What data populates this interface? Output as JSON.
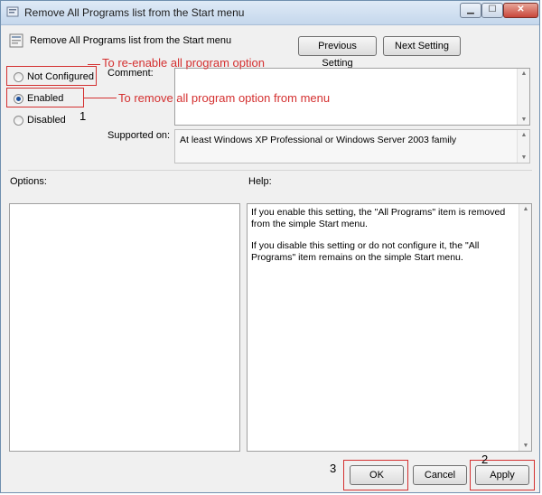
{
  "window": {
    "title": "Remove All Programs list from the Start menu"
  },
  "header": {
    "setting_name": "Remove All Programs list from the Start menu"
  },
  "nav": {
    "previous_label": "Previous Setting",
    "next_label": "Next Setting"
  },
  "state": {
    "options": [
      {
        "label": "Not Configured",
        "selected": false
      },
      {
        "label": "Enabled",
        "selected": true
      },
      {
        "label": "Disabled",
        "selected": false
      }
    ]
  },
  "comment": {
    "label": "Comment:",
    "value": ""
  },
  "supported": {
    "label": "Supported on:",
    "value": "At least Windows XP Professional or Windows Server 2003 family"
  },
  "options_panel": {
    "label": "Options:"
  },
  "help": {
    "label": "Help:",
    "paragraph1": "If you enable this setting, the \"All Programs\" item is removed from the simple Start menu.",
    "paragraph2": "If you disable this setting or do not configure it, the \"All Programs\" item remains on the simple Start menu."
  },
  "footer": {
    "ok_label": "OK",
    "cancel_label": "Cancel",
    "apply_label": "Apply"
  },
  "annotations": {
    "reenable": "To re-enable all program option",
    "remove": "To remove all program option from menu",
    "step1": "1",
    "step2": "2",
    "step3": "3",
    "color": "#d43030"
  }
}
